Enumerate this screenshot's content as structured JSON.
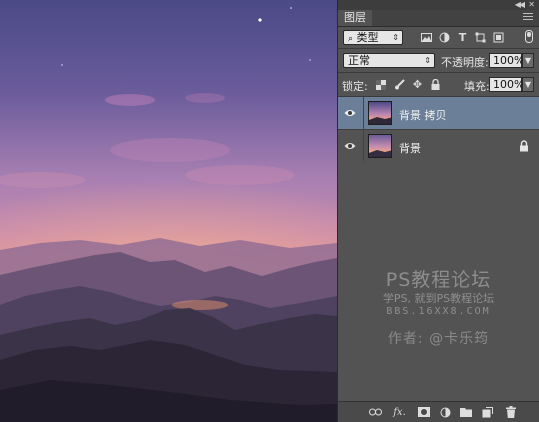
{
  "panel": {
    "tab_label": "图层",
    "filter_label": "类型",
    "blend_mode": "正常",
    "opacity_label": "不透明度:",
    "opacity_value": "100%",
    "lock_label": "锁定:",
    "fill_label": "填充:",
    "fill_value": "100%"
  },
  "layers": [
    {
      "name": "背景 拷贝",
      "active": true,
      "locked": false
    },
    {
      "name": "背景",
      "active": false,
      "locked": true
    }
  ],
  "watermark": {
    "line1": "PS教程论坛",
    "line2": "学PS, 就到PS教程论坛",
    "line3": "BBS.16XX8.COM",
    "line4": "作者: @卡乐筠"
  },
  "bottom_icons": [
    "link-icon",
    "fx-icon",
    "mask-icon",
    "adjustment-icon",
    "group-icon",
    "new-layer-icon",
    "trash-icon"
  ],
  "colors": {
    "active_layer": "#6b7f98",
    "panel_bg": "#535353"
  }
}
